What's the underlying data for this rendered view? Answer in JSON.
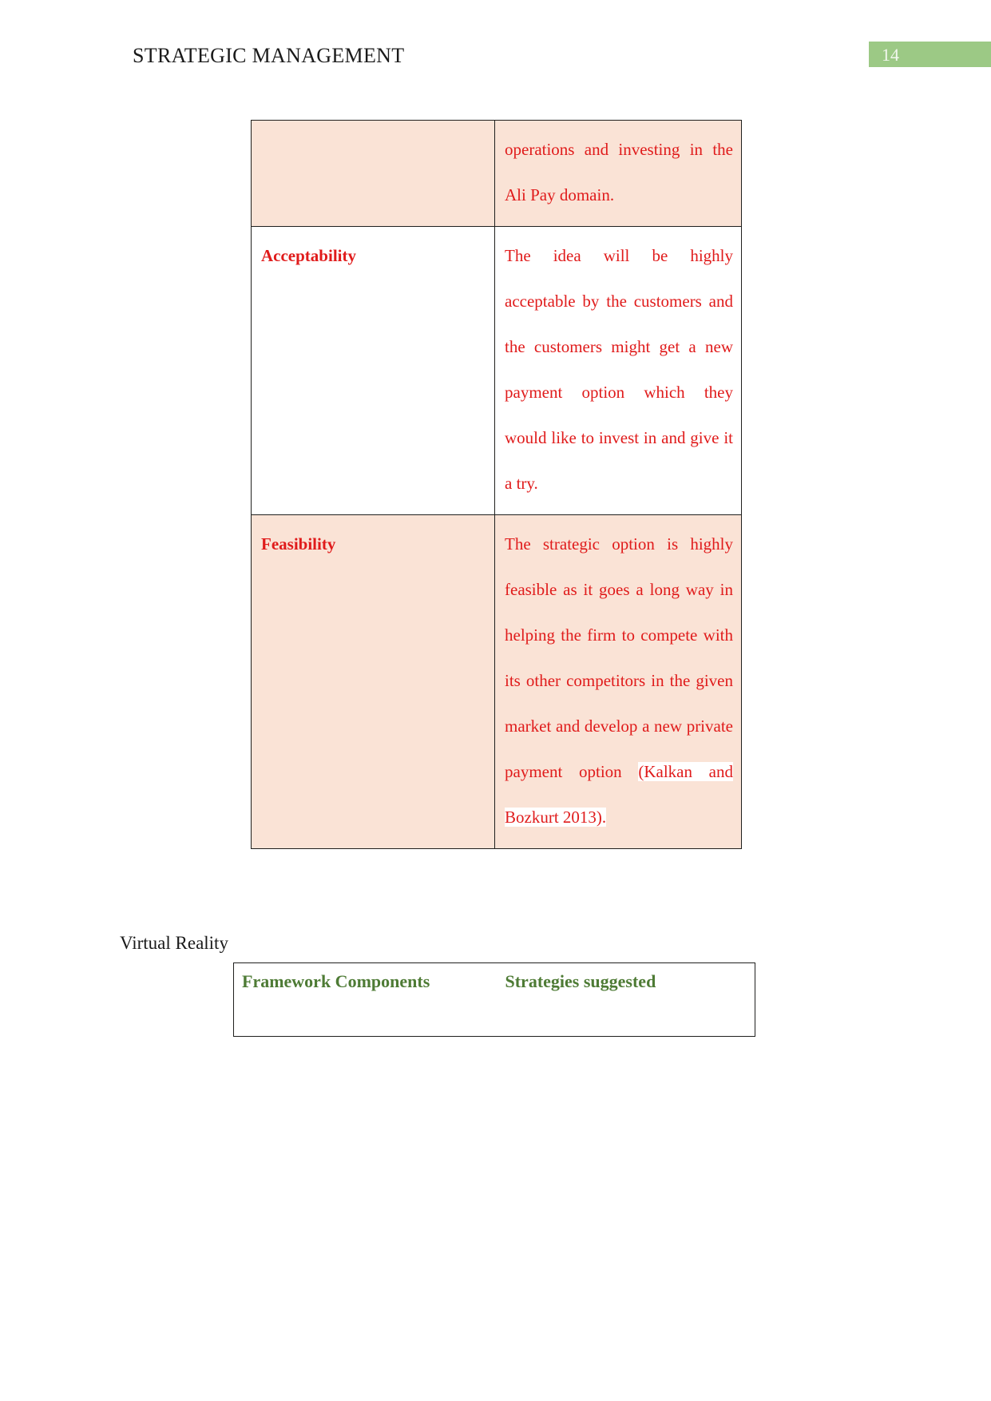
{
  "header": {
    "document_title": "STRATEGIC MANAGEMENT",
    "page_number": "14",
    "badge_color": "#9cc985"
  },
  "saf_table": {
    "accent_text_color": "#e01b1b",
    "shaded_row_color": "#fae3d6",
    "rows": [
      {
        "label": "",
        "text": "operations and investing in the Ali Pay domain.",
        "shaded": true
      },
      {
        "label": "Acceptability",
        "text": "The idea will be highly acceptable by the customers and the customers might get a new payment option which they would like to invest in and give it a try.",
        "shaded": false
      },
      {
        "label": "Feasibility",
        "text": "The strategic option is highly feasible as it goes a long way in helping the firm to compete with its other competitors in the given market and develop a new private payment option ",
        "citation": "(Kalkan and Bozkurt 2013).",
        "shaded": true
      }
    ]
  },
  "virtual_reality_section": {
    "heading": "Virtual Reality",
    "table": {
      "header_color": "#4e7b35",
      "columns": [
        "Framework Components",
        "Strategies suggested"
      ]
    }
  }
}
